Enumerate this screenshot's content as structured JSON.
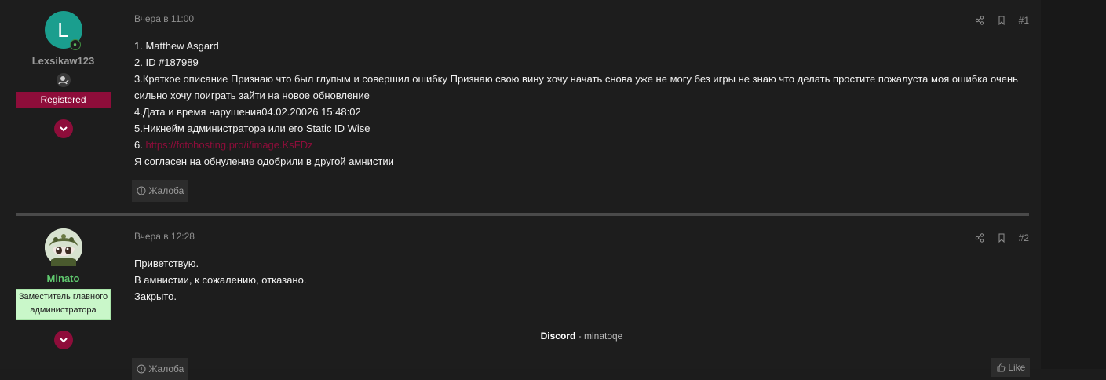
{
  "posts": [
    {
      "author": {
        "name": "Lexsikaw123",
        "avatar_letter": "L",
        "avatar_color": "#1a9e8e",
        "badge": "Registered"
      },
      "time": "Вчера в 11:00",
      "post_number": "#1",
      "lines": [
        "1. Matthew Asgard",
        "2. ID #187989",
        "3.Краткое описание Признаю что был глупым и совершил ошибку Признаю свою вину хочу начать снова уже не могу без игры не знаю что делать простите пожалуста моя ошибка очень сильно хочу поиграть зайти на новое обновление",
        "4.Дата и время нарушения04.02.20026 15:48:02",
        "5.Никнейм администратора или его Static ID Wise"
      ],
      "link_prefix": "6. ",
      "link_text": "https://fotohosting.pro/i/image.KsFDz",
      "last_line": "Я согласен на обнуление одобрили в другой амнистии",
      "report_label": "Жалоба"
    },
    {
      "author": {
        "name": "Minato",
        "badge_line1": "Заместитель главного",
        "badge_line2": "администратора"
      },
      "time": "Вчера в 12:28",
      "post_number": "#2",
      "lines": [
        "Приветствую.",
        "В амнистии, к сожалению, отказано.",
        "Закрыто."
      ],
      "signature_label": "Discord",
      "signature_sep": " - ",
      "signature_value": "minatoqe",
      "report_label": "Жалоба",
      "like_label": "Like"
    }
  ],
  "colors": {
    "accent": "#8e0d3a",
    "deputy_badge": "#c9f7c9",
    "minato_name": "#5fc86e"
  }
}
